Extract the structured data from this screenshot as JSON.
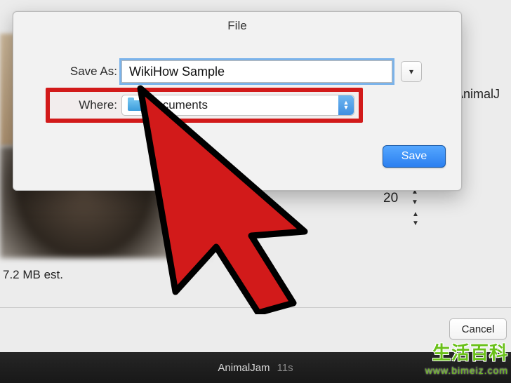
{
  "sheet": {
    "title": "File",
    "saveAs": {
      "label": "Save As:",
      "value": "WikiHow Sample"
    },
    "where": {
      "label": "Where:",
      "selected": "Documents"
    },
    "expand_tooltip": "▾",
    "save_label": "Save"
  },
  "cancel_label": "Cancel",
  "size_estimate": "7.2 MB est.",
  "visible_value": "20",
  "right_partial_label": "AnimalJ",
  "bottombar": {
    "clip_name": "AnimalJam",
    "duration": "11s"
  },
  "watermark": {
    "text": "生活百科",
    "url": "www.bimeiz.com"
  },
  "icons": {
    "folder": "folder-icon",
    "chevron_down": "chevron-down-icon",
    "updown": "updown-icon",
    "stepper": "stepper-icon",
    "cursor": "cursor-arrow"
  }
}
